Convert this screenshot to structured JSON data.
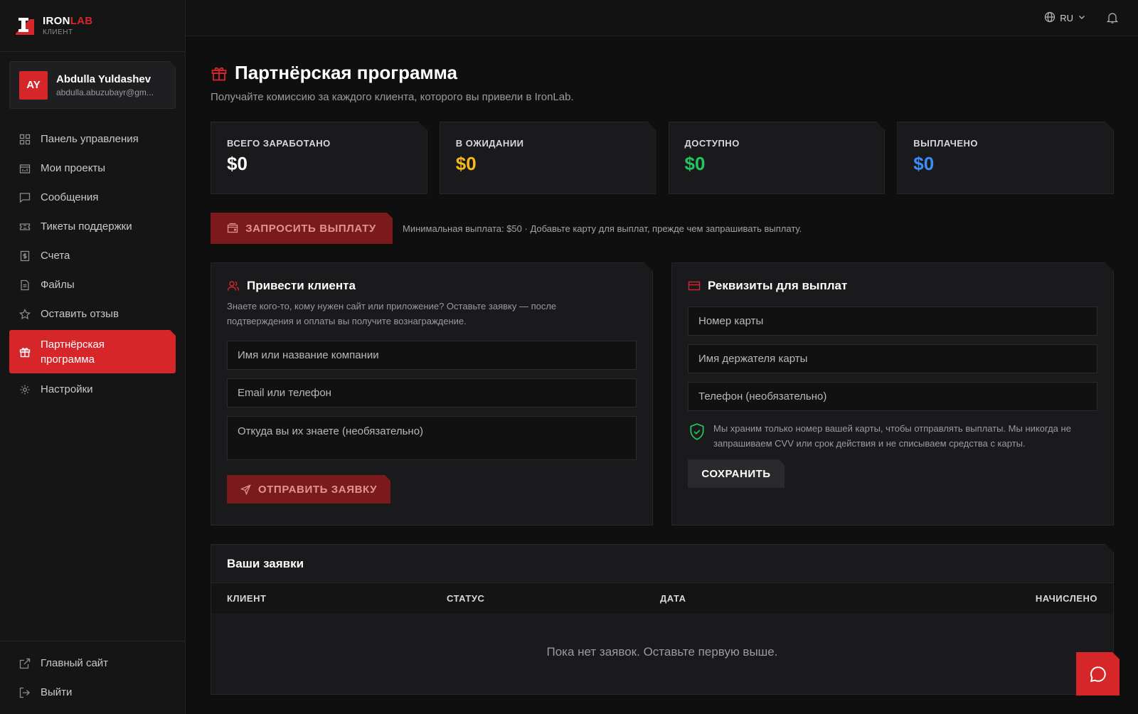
{
  "brand": {
    "name_a": "IRON",
    "name_b": "LAB",
    "subtitle": "КЛИЕНТ"
  },
  "user": {
    "initials": "AY",
    "name": "Abdulla Yuldashev",
    "email": "abdulla.abuzubayr@gm..."
  },
  "sidebar": {
    "items": [
      {
        "label": "Панель управления",
        "icon": "dashboard-icon"
      },
      {
        "label": "Мои проекты",
        "icon": "projects-icon"
      },
      {
        "label": "Сообщения",
        "icon": "messages-icon"
      },
      {
        "label": "Тикеты поддержки",
        "icon": "ticket-icon"
      },
      {
        "label": "Счета",
        "icon": "invoice-icon"
      },
      {
        "label": "Файлы",
        "icon": "file-icon"
      },
      {
        "label": "Оставить отзыв",
        "icon": "star-icon"
      },
      {
        "label": "Партнёрская программа",
        "icon": "gift-icon",
        "active": true
      },
      {
        "label": "Настройки",
        "icon": "gear-icon"
      }
    ],
    "bottom": [
      {
        "label": "Главный сайт",
        "icon": "external-link-icon"
      },
      {
        "label": "Выйти",
        "icon": "logout-icon"
      }
    ]
  },
  "topbar": {
    "lang": "RU"
  },
  "page": {
    "title": "Партнёрская программа",
    "subtitle": "Получайте комиссию за каждого клиента, которого вы привели в IronLab."
  },
  "stats": [
    {
      "label": "ВСЕГО ЗАРАБОТАНО",
      "value": "$0",
      "color": "#ffffff"
    },
    {
      "label": "В ОЖИДАНИИ",
      "value": "$0",
      "color": "#f5b91c"
    },
    {
      "label": "ДОСТУПНО",
      "value": "$0",
      "color": "#22c55e"
    },
    {
      "label": "ВЫПЛАЧЕНО",
      "value": "$0",
      "color": "#3b8df6"
    }
  ],
  "payout": {
    "button": "ЗАПРОСИТЬ ВЫПЛАТУ",
    "note": "Минимальная выплата: $50 · Добавьте карту для выплат, прежде чем запрашивать выплату."
  },
  "referral": {
    "title": "Привести клиента",
    "desc": "Знаете кого-то, кому нужен сайт или приложение? Оставьте заявку — после подтверждения и оплаты вы получите вознаграждение.",
    "name_placeholder": "Имя или название компании",
    "contact_placeholder": "Email или телефон",
    "source_placeholder": "Откуда вы их знаете (необязательно)",
    "submit": "ОТПРАВИТЬ ЗАЯВКУ"
  },
  "payout_details": {
    "title": "Реквизиты для выплат",
    "card_placeholder": "Номер карты",
    "holder_placeholder": "Имя держателя карты",
    "phone_placeholder": "Телефон (необязательно)",
    "security_note": "Мы храним только номер вашей карты, чтобы отправлять выплаты. Мы никогда не запрашиваем CVV или срок действия и не списываем средства с карты.",
    "save": "СОХРАНИТЬ"
  },
  "requests": {
    "title": "Ваши заявки",
    "columns": [
      "КЛИЕНТ",
      "СТАТУС",
      "ДАТА",
      "НАЧИСЛЕНО"
    ],
    "empty": "Пока нет заявок. Оставьте первую выше."
  },
  "colors": {
    "accent": "#d7262a",
    "accent_dim": "#7a1a1c"
  }
}
